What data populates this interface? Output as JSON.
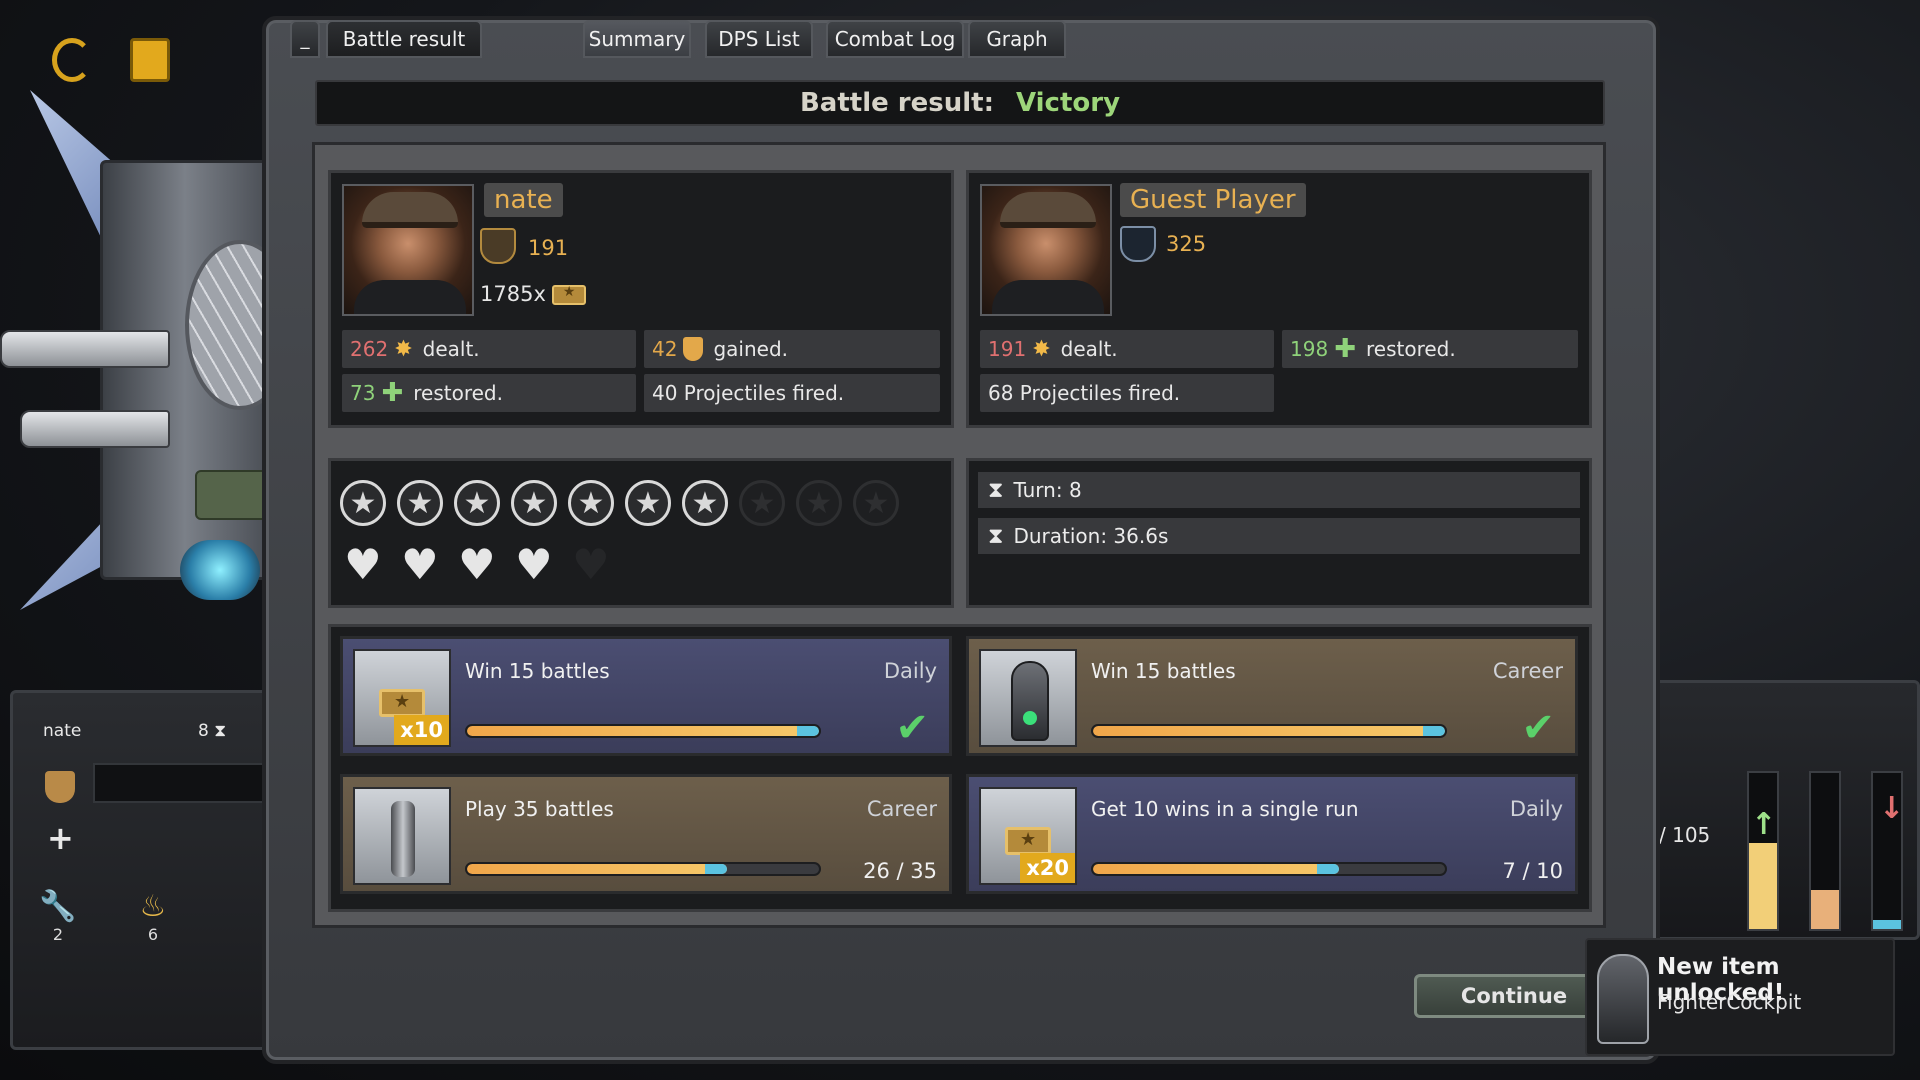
{
  "window": {
    "title_tab": "Battle result",
    "minimize_label": "_",
    "tabs": [
      "Summary",
      "DPS List",
      "Combat Log",
      "Graph"
    ],
    "active_tab": "Summary"
  },
  "result": {
    "label": "Battle result:",
    "value": "Victory"
  },
  "players": [
    {
      "name": "nate",
      "rank": "191",
      "coins": "1785x",
      "stats": [
        {
          "num": "262",
          "icon": "burst-icon",
          "text": "dealt."
        },
        {
          "num": "42",
          "icon": "shield-icon",
          "text": "gained."
        },
        {
          "num": "73",
          "icon": "plus-icon",
          "text": "restored."
        },
        {
          "num": "",
          "icon": "",
          "text": "40 Projectiles fired."
        }
      ]
    },
    {
      "name": "Guest Player",
      "rank": "325",
      "stats": [
        {
          "num": "191",
          "icon": "burst-icon",
          "text": "dealt."
        },
        {
          "num": "198",
          "icon": "plus-icon",
          "text": "restored."
        },
        {
          "num": "",
          "icon": "",
          "text": "68 Projectiles fired."
        }
      ]
    }
  ],
  "rating": {
    "stars_total": 10,
    "stars_earned": 7,
    "hearts_total": 5,
    "hearts_remaining": 4
  },
  "battle_info": {
    "turn": "Turn: 8",
    "duration": "Duration: 36.6s"
  },
  "quests": [
    {
      "title": "Win 15 battles",
      "type": "Daily",
      "progress": 1.0,
      "progress_text": "",
      "completed": true,
      "reward": "x10",
      "theme": "blue",
      "icon": "ticket-icon"
    },
    {
      "title": "Win 15 battles",
      "type": "Career",
      "progress": 1.0,
      "progress_text": "",
      "completed": true,
      "reward": "",
      "theme": "tan",
      "icon": "cockpit-icon"
    },
    {
      "title": "Play 35 battles",
      "type": "Career",
      "progress": 0.74,
      "progress_text": "26 / 35",
      "completed": false,
      "reward": "",
      "theme": "tan",
      "icon": "gun-icon"
    },
    {
      "title": "Get 10 wins in a single run",
      "type": "Daily",
      "progress": 0.7,
      "progress_text": "7 / 10",
      "completed": false,
      "reward": "x20",
      "theme": "blue",
      "icon": "ticket-icon"
    }
  ],
  "continue_label": "Continue",
  "toast": {
    "title": "New item unlocked!",
    "item": "FighterCockpit"
  },
  "left_hud": {
    "name": "nate",
    "turn": "8",
    "wrench_count": "2",
    "fire_count": "6"
  },
  "right_hud": {
    "count": "/ 105"
  },
  "colors": {
    "victory": "#9dd67a",
    "player_name": "#e8b152",
    "damage": "#e07070",
    "heal": "#8fd27a",
    "quest_blue": "#4b4e72",
    "quest_tan": "#6d5f4b"
  }
}
